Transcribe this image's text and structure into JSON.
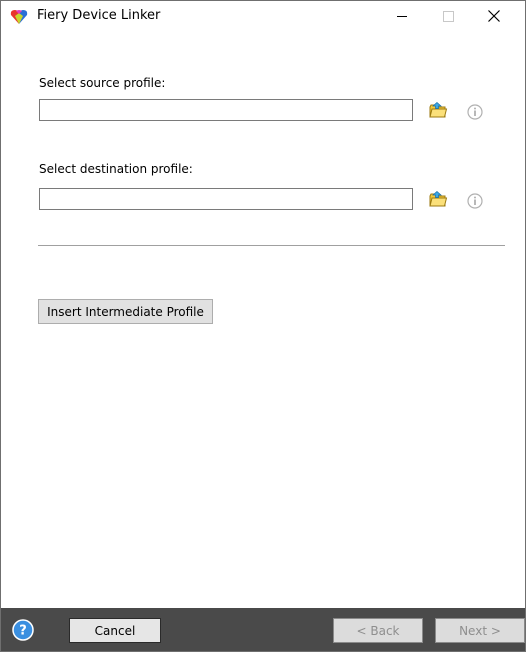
{
  "window": {
    "title": "Fiery Device Linker"
  },
  "source": {
    "label": "Select source profile:",
    "value": ""
  },
  "destination": {
    "label": "Select destination profile:",
    "value": ""
  },
  "buttons": {
    "insert_intermediate": "Insert Intermediate Profile",
    "cancel": "Cancel",
    "back": "< Back",
    "next": "Next >"
  },
  "icons": {
    "app": "fiery-heart-icon",
    "browse": "open-folder-icon",
    "info": "info-icon",
    "help": "help-icon"
  },
  "colors": {
    "footer_bg": "#4a4a4a",
    "help_blue": "#3a8fe0",
    "disabled_text": "#8e8e8e"
  }
}
